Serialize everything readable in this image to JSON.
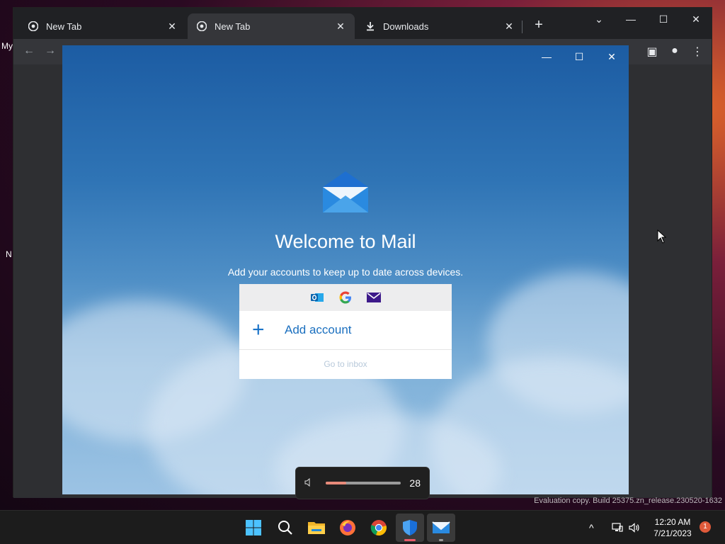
{
  "desktop": {
    "frag_top": "My",
    "frag_mid": "N"
  },
  "browser": {
    "tabs": [
      {
        "title": "New Tab",
        "icon": "chrome-icon",
        "close": "✕"
      },
      {
        "title": "New Tab",
        "icon": "chrome-icon",
        "close": "✕"
      },
      {
        "title": "Downloads",
        "icon": "download-icon",
        "close": "✕"
      }
    ],
    "new_tab": "+",
    "window_controls": {
      "dropdown": "⌄",
      "minimize": "—",
      "maximize": "☐",
      "close": "✕"
    },
    "toolbar": {
      "back": "←",
      "forward": "→",
      "sidebar": "▣",
      "profile": "●",
      "menu": "⋮"
    }
  },
  "mail": {
    "window_controls": {
      "minimize": "—",
      "maximize": "☐",
      "close": "✕"
    },
    "title": "Welcome to Mail",
    "subtitle": "Add your accounts to keep up to date across devices.",
    "providers": [
      "outlook-icon",
      "google-icon",
      "mail-icon"
    ],
    "add_account_label": "Add account",
    "go_to_inbox_label": "Go to inbox"
  },
  "volume": {
    "value": "28",
    "level": 0.28
  },
  "watermark": "Evaluation copy. Build 25375.zn_release.230520-1632",
  "taskbar": {
    "apps": [
      "windows-start-icon",
      "search-icon",
      "file-explorer-icon",
      "firefox-icon",
      "chrome-icon",
      "windows-security-icon",
      "mail-icon"
    ],
    "tray_chevron": "^",
    "time": "12:20 AM",
    "date": "7/21/2023",
    "notifications": "1"
  },
  "colors": {
    "accent": "#1a6fbf",
    "mail_bg_top": "#1c5ca3",
    "volume_fill": "#e88a7a"
  }
}
